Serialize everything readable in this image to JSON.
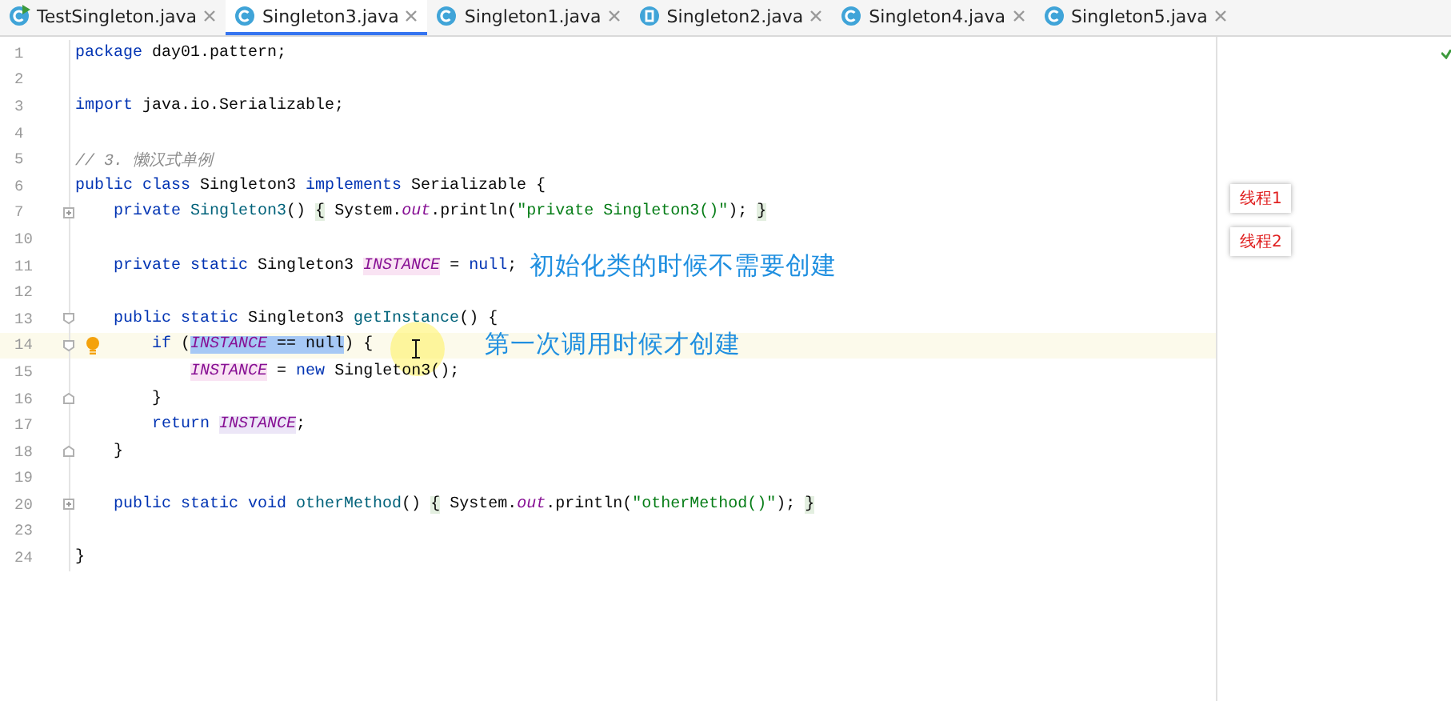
{
  "tabs": [
    {
      "label": "TestSingleton.java",
      "kind": "runnable",
      "selected": false
    },
    {
      "label": "Singleton3.java",
      "kind": "class",
      "selected": true
    },
    {
      "label": "Singleton1.java",
      "kind": "class",
      "selected": false
    },
    {
      "label": "Singleton2.java",
      "kind": "enum",
      "selected": false
    },
    {
      "label": "Singleton4.java",
      "kind": "class",
      "selected": false
    },
    {
      "label": "Singleton5.java",
      "kind": "class",
      "selected": false
    }
  ],
  "editor": {
    "lines": [
      {
        "number": "1",
        "kind": "plain",
        "code": [
          {
            "kind": "kw",
            "text": "package "
          },
          {
            "kind": "plain",
            "text": "day01.pattern;"
          }
        ]
      },
      {
        "number": "2",
        "kind": "plain"
      },
      {
        "number": "3",
        "kind": "plain",
        "code": [
          {
            "kind": "kw",
            "text": "import "
          },
          {
            "kind": "plain",
            "text": "java.io.Serializable;"
          }
        ]
      },
      {
        "number": "4",
        "kind": "plain"
      },
      {
        "number": "5",
        "kind": "plain",
        "code": [
          {
            "kind": "comment",
            "text": "// 3. 懒汉式单例"
          }
        ]
      },
      {
        "number": "6",
        "kind": "plain",
        "code": [
          {
            "kind": "kw",
            "text": "public class "
          },
          {
            "kind": "plain",
            "text": "Singleton3 "
          },
          {
            "kind": "kw",
            "text": "implements "
          },
          {
            "kind": "plain",
            "text": "Serializable {"
          }
        ]
      },
      {
        "number": "7",
        "kind": "collapsed",
        "code": [
          {
            "kind": "kw",
            "text": "    private "
          },
          {
            "kind": "method",
            "text": "Singleton3"
          },
          {
            "kind": "plain",
            "text": "() "
          },
          {
            "kind": "brace",
            "text": "{"
          },
          {
            "kind": "plain",
            "text": " System."
          },
          {
            "kind": "static",
            "text": "out"
          },
          {
            "kind": "plain",
            "text": ".println("
          },
          {
            "kind": "str",
            "text": "\"private Singleton3()\""
          },
          {
            "kind": "plain",
            "text": "); "
          },
          {
            "kind": "brace",
            "text": "}"
          }
        ]
      },
      {
        "number": "10",
        "kind": "plain"
      },
      {
        "number": "11",
        "kind": "plain",
        "code": [
          {
            "kind": "kw",
            "text": "    private static "
          },
          {
            "kind": "plain",
            "text": "Singleton3 "
          },
          {
            "kind": "field",
            "text": "INSTANCE"
          },
          {
            "kind": "plain",
            "text": " = "
          },
          {
            "kind": "kw",
            "text": "null"
          },
          {
            "kind": "plain",
            "text": ";"
          }
        ],
        "annotation": "初始化类的时候不需要创建"
      },
      {
        "number": "12",
        "kind": "plain"
      },
      {
        "number": "13",
        "kind": "fold_start",
        "code": [
          {
            "kind": "kw",
            "text": "    public static "
          },
          {
            "kind": "plain",
            "text": "Singleton3 "
          },
          {
            "kind": "method",
            "text": "getInstance"
          },
          {
            "kind": "plain",
            "text": "() {"
          }
        ]
      },
      {
        "number": "14",
        "kind": "fold_start",
        "current": true,
        "bulb": true,
        "pointer": true,
        "code": [
          {
            "kind": "kw",
            "text": "        if "
          },
          {
            "kind": "plain",
            "text": "("
          },
          {
            "kind": "selfield",
            "text": "INSTANCE"
          },
          {
            "kind": "sel",
            "text": " == null"
          },
          {
            "kind": "plain",
            "text": ") {"
          }
        ],
        "annotation": "第一次调用时候才创建"
      },
      {
        "number": "15",
        "kind": "plain",
        "code": [
          {
            "kind": "fieldpad",
            "text": "            INSTANCE"
          },
          {
            "kind": "plain",
            "text": " = "
          },
          {
            "kind": "kw",
            "text": "new "
          },
          {
            "kind": "plain",
            "text": "Singleton3();"
          }
        ]
      },
      {
        "number": "16",
        "kind": "fold_end",
        "code": [
          {
            "kind": "plain",
            "text": "        }"
          }
        ]
      },
      {
        "number": "17",
        "kind": "plain",
        "code": [
          {
            "kind": "kw",
            "text": "        return "
          },
          {
            "kind": "field2",
            "text": "INSTANCE"
          },
          {
            "kind": "plain",
            "text": ";"
          }
        ]
      },
      {
        "number": "18",
        "kind": "fold_end",
        "code": [
          {
            "kind": "plain",
            "text": "    }"
          }
        ]
      },
      {
        "number": "19",
        "kind": "plain"
      },
      {
        "number": "20",
        "kind": "collapsed",
        "code": [
          {
            "kind": "kw",
            "text": "    public static void "
          },
          {
            "kind": "method",
            "text": "otherMethod"
          },
          {
            "kind": "plain",
            "text": "() "
          },
          {
            "kind": "brace",
            "text": "{"
          },
          {
            "kind": "plain",
            "text": " System."
          },
          {
            "kind": "static",
            "text": "out"
          },
          {
            "kind": "plain",
            "text": ".println("
          },
          {
            "kind": "str",
            "text": "\"otherMethod()\""
          },
          {
            "kind": "plain",
            "text": "); "
          },
          {
            "kind": "brace",
            "text": "}"
          }
        ]
      },
      {
        "number": "23",
        "kind": "plain"
      },
      {
        "number": "24",
        "kind": "plain",
        "code": [
          {
            "kind": "plain",
            "text": "}"
          }
        ]
      }
    ]
  },
  "side_notes": [
    "线程1",
    "线程2"
  ]
}
